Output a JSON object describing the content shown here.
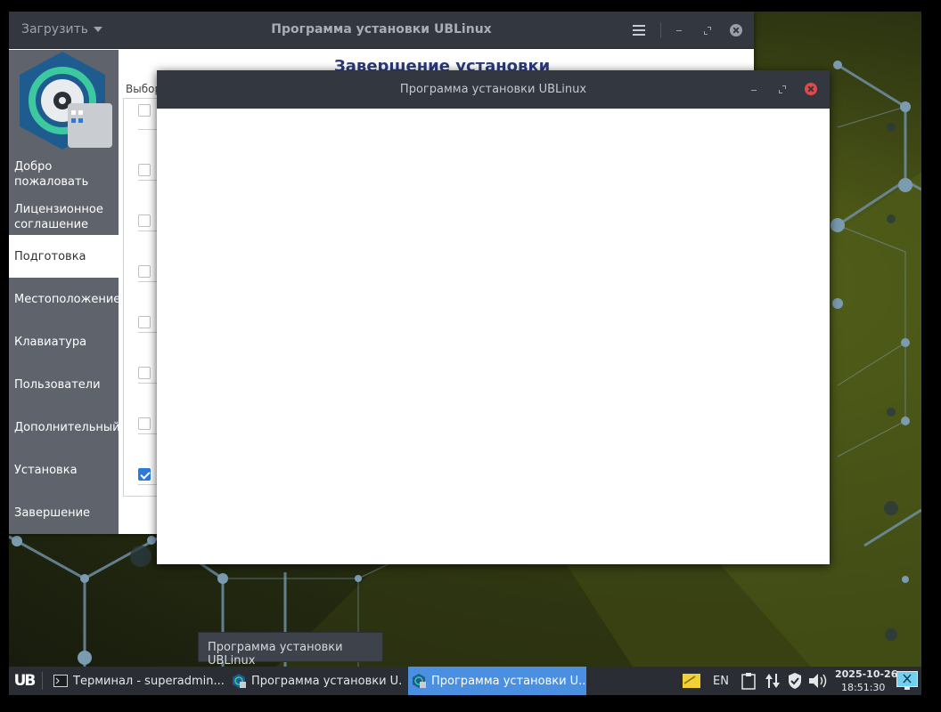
{
  "main_window": {
    "menu_label": "Загрузить",
    "title": "Программа установки UBLinux",
    "heading": "Завершение установки",
    "subheading": "Выбор",
    "sidebar": [
      {
        "label": "Добро пожаловать",
        "active": false
      },
      {
        "label": "Лицензионное соглашение",
        "active": false
      },
      {
        "label": "Подготовка",
        "active": true
      },
      {
        "label": "Местоположение",
        "active": false
      },
      {
        "label": "Клавиатура",
        "active": false
      },
      {
        "label": "Пользователи",
        "active": false
      },
      {
        "label": "Дополнительный",
        "active": false
      },
      {
        "label": "Установка",
        "active": false
      },
      {
        "label": "Завершение",
        "active": false
      }
    ],
    "checkboxes": [
      false,
      false,
      false,
      false,
      false,
      false,
      false,
      true
    ]
  },
  "dialog": {
    "title": "Программа установки UBLinux"
  },
  "tooltip": "Программа установки UBLinux",
  "taskbar": {
    "start_label": "UB",
    "tasks": [
      {
        "label": "Терминал - superadmin...",
        "icon": "terminal-icon",
        "active": false
      },
      {
        "label": "Программа установки U...",
        "icon": "installer-icon",
        "active": false
      },
      {
        "label": "Программа установки U...",
        "icon": "installer-icon",
        "active": true
      }
    ],
    "keyboard_layout": "EN",
    "date": "2025-10-26",
    "time": "18:51:30"
  },
  "colors": {
    "accent": "#4a8fe0",
    "titlebar": "#33373f",
    "sidebar": "#5f636b",
    "heading": "#2b3a78",
    "close_active": "#e24a4a"
  }
}
